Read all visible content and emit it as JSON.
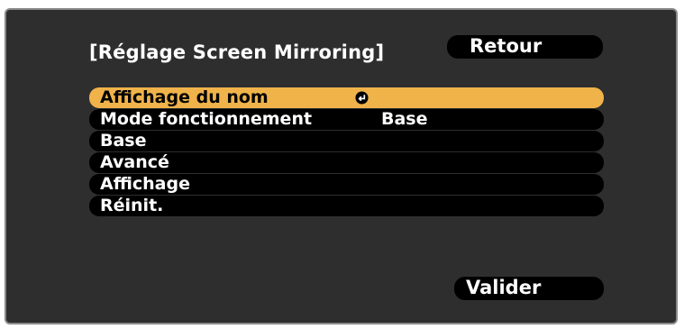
{
  "dialog": {
    "title": "[Réglage Screen Mirroring]",
    "back_label": "Retour",
    "confirm_label": "Valider"
  },
  "menu": {
    "items": [
      {
        "label": "Affichage du nom",
        "value": "",
        "icon": "enter-icon",
        "selected": true
      },
      {
        "label": "Mode fonctionnement",
        "value": "Base",
        "selected": false
      },
      {
        "label": "Base",
        "value": "",
        "selected": false
      },
      {
        "label": "Avancé",
        "value": "",
        "selected": false
      },
      {
        "label": "Affichage",
        "value": "",
        "selected": false
      },
      {
        "label": "Réinit.",
        "value": "",
        "selected": false
      }
    ]
  },
  "colors": {
    "background": "#2e2e2e",
    "highlight": "#f0b34a",
    "pill": "#000000",
    "text": "#ffffff"
  }
}
